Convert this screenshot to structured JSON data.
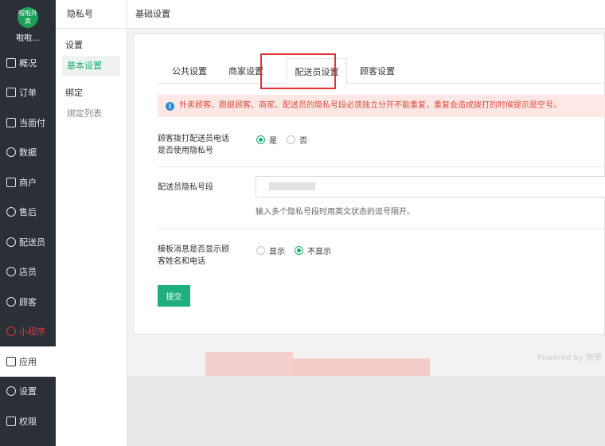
{
  "sidebar": {
    "logo_text": "啦啦外卖",
    "brand": "啦啦...",
    "items": [
      {
        "label": "概况",
        "icon": "overview-icon"
      },
      {
        "label": "订单",
        "icon": "order-icon"
      },
      {
        "label": "当面付",
        "icon": "pay-icon"
      },
      {
        "label": "数据",
        "icon": "data-icon"
      },
      {
        "label": "商户",
        "icon": "store-icon"
      },
      {
        "label": "售后",
        "icon": "aftersale-icon"
      },
      {
        "label": "配送员",
        "icon": "deliverer-icon"
      },
      {
        "label": "店员",
        "icon": "clerk-icon"
      },
      {
        "label": "顾客",
        "icon": "customer-icon"
      },
      {
        "label": "小程序",
        "icon": "mini-program-icon"
      },
      {
        "label": "应用",
        "icon": "apps-icon"
      },
      {
        "label": "设置",
        "icon": "settings-icon"
      },
      {
        "label": "权限",
        "icon": "lock-icon"
      }
    ]
  },
  "subbar": {
    "title": "隐私号",
    "group1": "设置",
    "link_basic": "基本设置",
    "group2": "绑定",
    "link_bind": "绑定列表"
  },
  "header": {
    "title": "基础设置"
  },
  "tabs": [
    "公共设置",
    "商家设置",
    "配送员设置",
    "顾客设置"
  ],
  "active_tab": "配送员设置",
  "notice": "外卖顾客、跑腿顾客、商家、配送员的隐私号段必须独立分开不能重复，重复会造成拨打的时候提示是空号。",
  "form": {
    "q1_label_line1": "顾客拨打配送员电话",
    "q1_label_line2": "是否使用隐私号",
    "q1_yes": "是",
    "q1_no": "否",
    "q1_selected": "是",
    "seg_label": "配送员隐私号段",
    "seg_value": "",
    "seg_help": "输入多个隐私号段时用英文状态的逗号隔开。",
    "q3_label_line1": "模板消息是否显示顾",
    "q3_label_line2": "客姓名和电话",
    "q3_show": "显示",
    "q3_hide": "不显示",
    "q3_selected": "不显示",
    "submit": "提交"
  },
  "footer": {
    "powered": "Powered by 微擎"
  },
  "colors": {
    "accent": "#1aad6d",
    "sidebar_bg": "#2b2f36",
    "notice_bg": "#fde8e6",
    "notice_text": "#e04a3f",
    "highlight": "#e03232"
  }
}
